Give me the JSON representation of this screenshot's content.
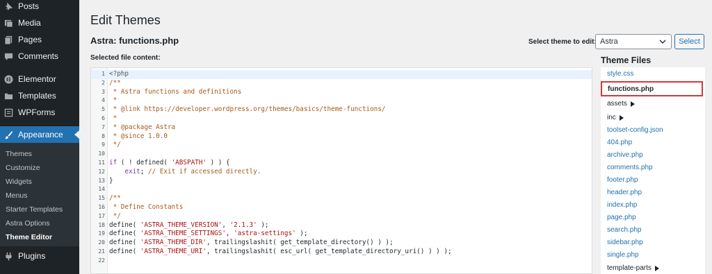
{
  "sidebar": {
    "items": [
      {
        "label": "Posts",
        "icon": "pushpin-icon"
      },
      {
        "label": "Media",
        "icon": "media-icon"
      },
      {
        "label": "Pages",
        "icon": "pages-icon"
      },
      {
        "label": "Comments",
        "icon": "comments-icon"
      },
      {
        "label": "Elementor",
        "icon": "elementor-icon"
      },
      {
        "label": "Templates",
        "icon": "folder-icon"
      },
      {
        "label": "WPForms",
        "icon": "forms-icon"
      },
      {
        "label": "Appearance",
        "icon": "paintbrush-icon"
      },
      {
        "label": "Plugins",
        "icon": "plugin-icon"
      }
    ],
    "submenu": [
      "Themes",
      "Customize",
      "Widgets",
      "Menus",
      "Starter Templates",
      "Astra Options",
      "Theme Editor"
    ]
  },
  "page": {
    "title": "Edit Themes",
    "file_title": "Astra: functions.php",
    "selected_label": "Selected file content:"
  },
  "theme_select": {
    "label": "Select theme to edit:",
    "value": "Astra",
    "button": "Select"
  },
  "code": {
    "line_numbers": [
      "1",
      "2",
      "3",
      "4",
      "5",
      "6",
      "7",
      "8",
      "9",
      "10",
      "11",
      "12",
      "13",
      "14",
      "15",
      "16",
      "17",
      "18",
      "19",
      "20",
      "21",
      "22"
    ],
    "lines": [
      "<?php",
      "/**",
      " * Astra functions and definitions",
      " *",
      " * @link https://developer.wordpress.org/themes/basics/theme-functions/",
      " *",
      " * @package Astra",
      " * @since 1.0.0",
      " */",
      "",
      "if ( ! defined( 'ABSPATH' ) ) {",
      "    exit; // Exit if accessed directly.",
      "}",
      "",
      "/**",
      " * Define Constants",
      " */",
      "define( 'ASTRA_THEME_VERSION', '2.1.3' );",
      "define( 'ASTRA_THEME_SETTINGS', 'astra-settings' );",
      "define( 'ASTRA_THEME_DIR', trailingslashit( get_template_directory() ) );",
      "define( 'ASTRA_THEME_URI', trailingslashit( esc_url( get_template_directory_uri() ) ) );",
      ""
    ]
  },
  "theme_files": {
    "heading": "Theme Files",
    "files": [
      "style.css",
      "functions.php",
      "assets",
      "inc",
      "toolset-config.json",
      "404.php",
      "archive.php",
      "comments.php",
      "footer.php",
      "header.php",
      "index.php",
      "page.php",
      "search.php",
      "sidebar.php",
      "single.php",
      "template-parts"
    ]
  },
  "colors": {
    "sidebar_bg": "#1d2327",
    "active_bg": "#2271b1",
    "link": "#2271b1",
    "highlight_border": "#d63638"
  }
}
